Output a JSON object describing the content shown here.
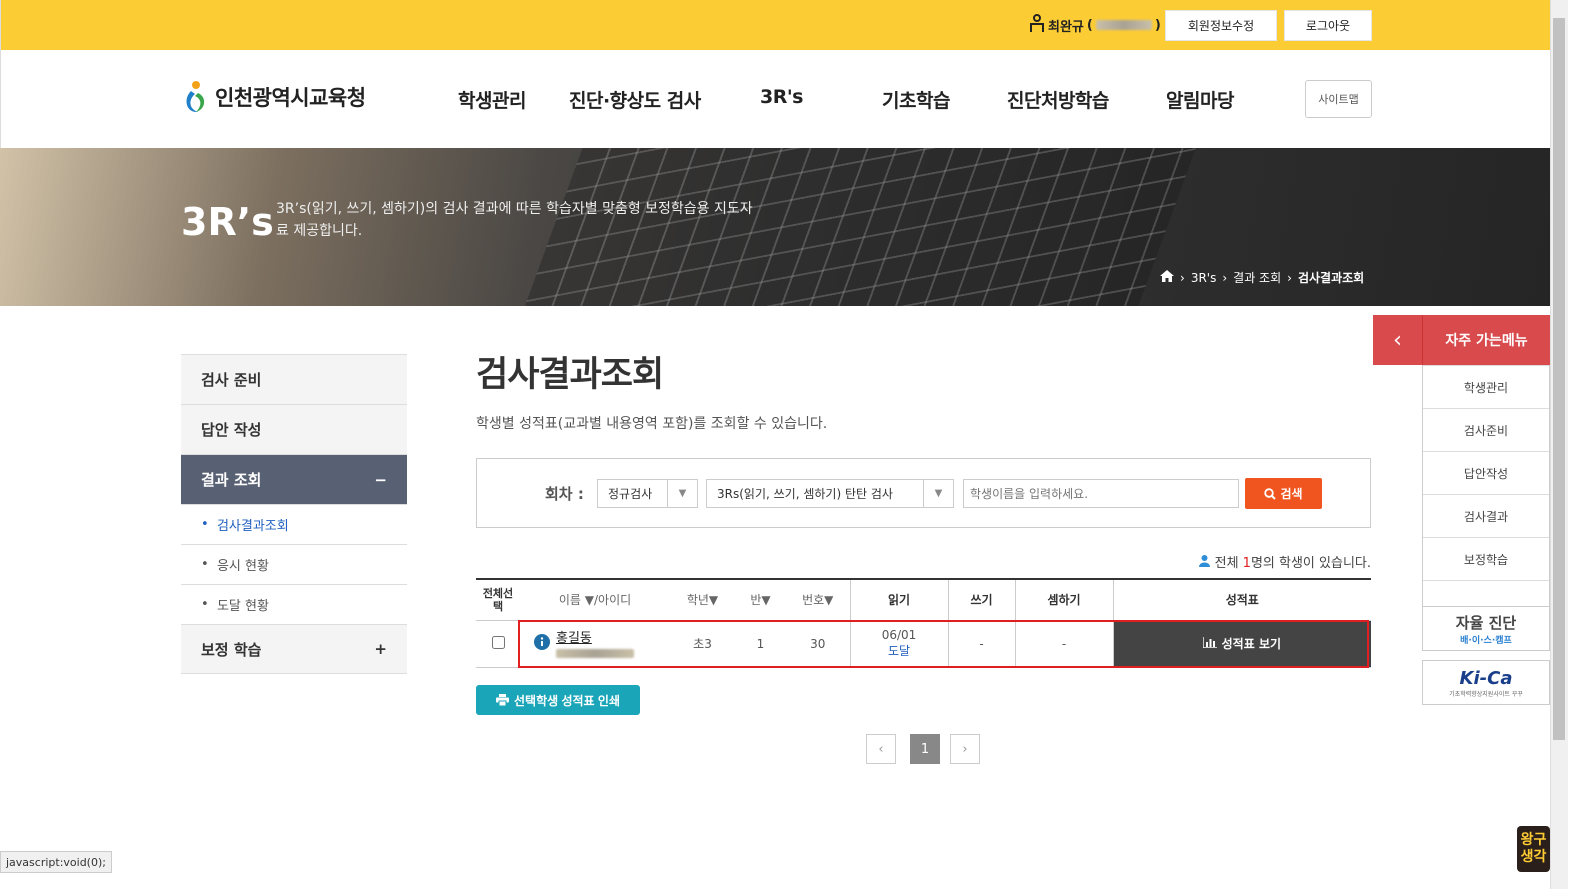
{
  "topbar": {
    "user_name": "최완규",
    "edit_label": "회원정보수정",
    "logout_label": "로그아웃"
  },
  "header": {
    "logo_text": "인천광역시교육청",
    "nav": [
      "학생관리",
      "진단·향상도 검사",
      "3R's",
      "기초학습",
      "진단처방학습",
      "알림마당"
    ],
    "sitemap": "사이트맵"
  },
  "banner": {
    "title": "3R’s",
    "desc": "3R’s(읽기, 쓰기, 셈하기)의 검사 결과에 따른 학습자별 맞춤형 보정학습용 지도자료 제공합니다.",
    "breadcrumb": [
      "3R's",
      "결과 조회",
      "검사결과조회"
    ]
  },
  "lnb": {
    "items": [
      "검사 준비",
      "답안 작성",
      "결과 조회",
      "보정 학습"
    ],
    "minus": "−",
    "plus": "+",
    "subs": [
      "검사결과조회",
      "응시 현황",
      "도달 현황"
    ]
  },
  "main": {
    "title": "검사결과조회",
    "desc": "학생별 성적표(교과별 내용영역 포함)를 조회할 수 있습니다."
  },
  "search": {
    "label": "회차 :",
    "type": "정규검사",
    "exam": "3Rs(읽기, 쓰기, 셈하기) 탄탄 검사",
    "placeholder": "학생이름을 입력하세요.",
    "button": "검색"
  },
  "count": {
    "prefix": "전체 ",
    "n": "1",
    "suffix": "명의 학생이 있습니다."
  },
  "table": {
    "headers": {
      "select": "전체선택",
      "name": "이름",
      "id": "/아이디",
      "grade": "학년",
      "class": "반",
      "num": "번호",
      "read": "읽기",
      "write": "쓰기",
      "calc": "셈하기",
      "report": "성적표"
    },
    "row": {
      "name": "홍길동",
      "grade": "초3",
      "class": "1",
      "num": "30",
      "read_date": "06/01",
      "read_status": "도달",
      "write": "-",
      "calc": "-",
      "report_btn": "성적표 보기"
    }
  },
  "print_btn": "선택학생 성적표 인쇄",
  "pager": {
    "current": "1"
  },
  "quick": {
    "title": "자주 가는메뉴",
    "items": [
      "학생관리",
      "검사준비",
      "답안작성",
      "검사결과",
      "보정학습"
    ],
    "ban1_title": "자율 진단",
    "ban1_sub": "배·이·스·캠프",
    "ban2_title": "Ki-Ca",
    "ban2_sub": "기초학력향상지원사이트 꾸꾸"
  },
  "status": "javascript:void(0);",
  "corner": "왕구생각"
}
